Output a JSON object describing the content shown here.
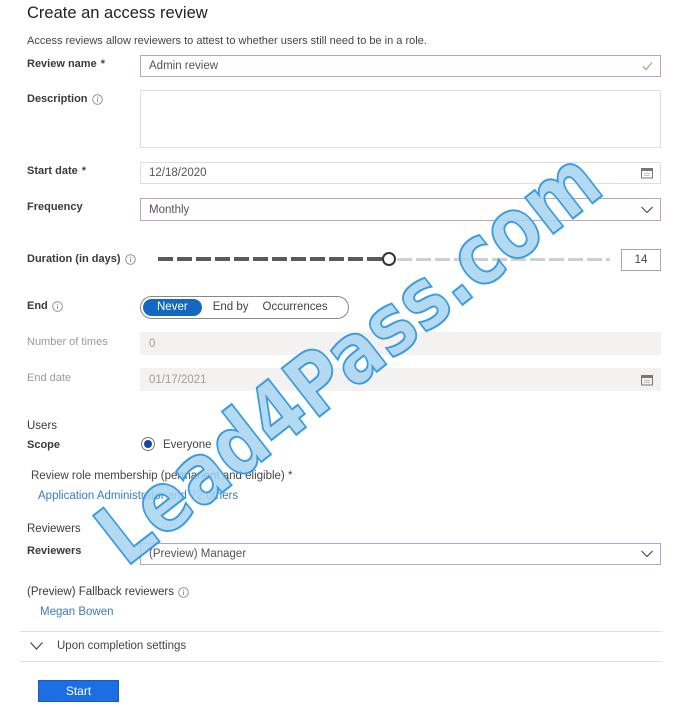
{
  "page": {
    "title": "Create an access review",
    "description": "Access reviews allow reviewers to attest to whether users still need to be in a role."
  },
  "form": {
    "review_name": {
      "label": "Review name",
      "required_mark": "*",
      "value": "Admin review",
      "valid_icon": "checkmark-icon"
    },
    "description": {
      "label": "Description",
      "value": "",
      "info_icon": "info-icon"
    },
    "start_date": {
      "label": "Start date",
      "required_mark": "*",
      "value": "12/18/2020",
      "icon": "calendar-icon"
    },
    "frequency": {
      "label": "Frequency",
      "selected": "Monthly",
      "icon": "chevron-down-icon"
    },
    "duration": {
      "label": "Duration (in days)",
      "value": "14",
      "slider_fraction": 0.51,
      "info_icon": "info-icon"
    },
    "end": {
      "label": "End",
      "options": [
        "Never",
        "End by",
        "Occurrences"
      ],
      "selected": "Never",
      "info_icon": "info-icon"
    },
    "number_of_times": {
      "label": "Number of times",
      "value": "0",
      "disabled": true
    },
    "end_date": {
      "label": "End date",
      "value": "01/17/2021",
      "disabled": true,
      "icon": "calendar-icon"
    }
  },
  "users": {
    "heading": "Users",
    "scope_label": "Scope",
    "scope_option": "Everyone",
    "scope_selected": true,
    "role_membership_label": "Review role membership (permanent and eligible) *",
    "role_membership_link": "Application Administrator and 72 others"
  },
  "reviewers": {
    "heading": "Reviewers",
    "label": "Reviewers",
    "selected": "(Preview) Manager"
  },
  "fallback": {
    "label": "(Preview) Fallback reviewers",
    "reviewer": "Megan Bowen"
  },
  "completion": {
    "label": "Upon completion settings",
    "expanded": false
  },
  "actions": {
    "start_label": "Start"
  },
  "watermark": "Lead4Pass.com",
  "colors": {
    "accent": "#1568c0",
    "button": "#1c6fe3",
    "link": "#3b7bbf",
    "focus_border": "#b8a3c6",
    "watermark_fill": "#a7d3f0",
    "watermark_stroke": "#3a9be0"
  }
}
